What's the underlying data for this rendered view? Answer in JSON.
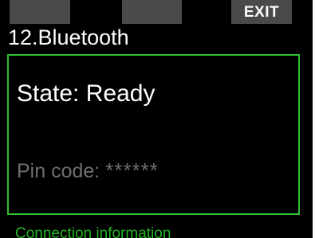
{
  "softkeys": {
    "left_label": "",
    "middle_label": "",
    "right_label": "EXIT"
  },
  "page": {
    "title": "12.Bluetooth"
  },
  "panel": {
    "state_label": "State:",
    "state_value": "Ready",
    "pin_label": "Pin code:",
    "pin_value": "******"
  },
  "footer": {
    "label": "Connection information"
  },
  "colors": {
    "background": "#000000",
    "softkey": "#4a4a4a",
    "accent_green": "#2ec02e",
    "text_primary": "#ffffff",
    "text_dimmed": "#6e6e6e"
  }
}
